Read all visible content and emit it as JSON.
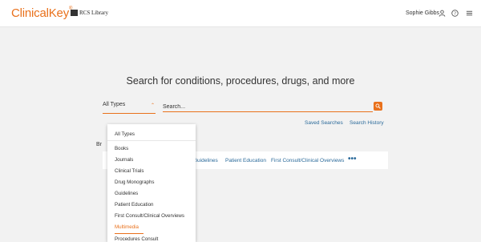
{
  "header": {
    "logo": "ClinicalKey",
    "logo_mark": "®",
    "partner_logo": "RCS Library",
    "user_name": "Sophie Gibbs",
    "icons": [
      "user-icon",
      "help-icon",
      "menu-icon"
    ]
  },
  "main": {
    "headline": "Search for conditions, procedures, drugs, and more",
    "type_select": "All Types",
    "search_placeholder": "Search...",
    "saved_searches": "Saved Searches",
    "search_history": "Search History",
    "browse_label": "Br",
    "browse_items": [
      "Guidelines",
      "Patient Education",
      "First Consult/Clinical Overviews"
    ],
    "more": "•••"
  },
  "dropdown": {
    "items": [
      "All Types",
      "Books",
      "Journals",
      "Clinical Trials",
      "Drug Monographs",
      "Guidelines",
      "Patient Education",
      "First Consult/Clinical Overviews",
      "Multimedia",
      "Procedures Consult"
    ],
    "selected": "Multimedia"
  },
  "colors": {
    "accent": "#e9711c",
    "link": "#2b6a9a",
    "background": "#f2f2f2"
  }
}
